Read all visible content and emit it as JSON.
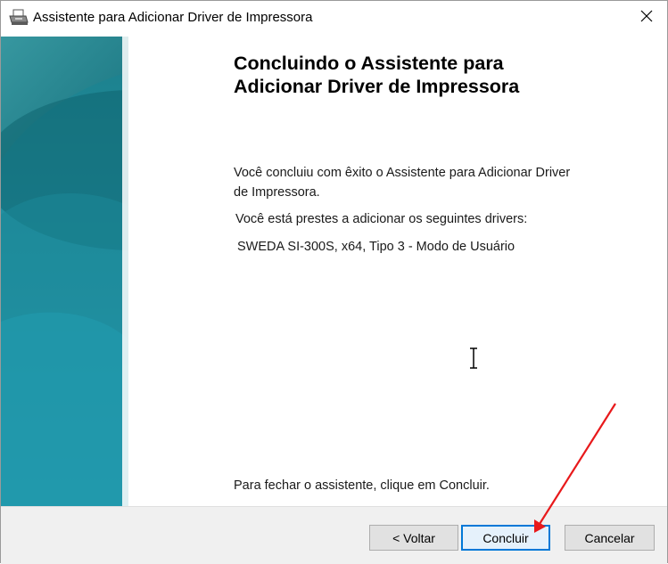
{
  "window": {
    "title": "Assistente para Adicionar Driver de Impressora",
    "icon": "printer-icon",
    "close_icon": "close-icon"
  },
  "content": {
    "heading_line1": "Concluindo o Assistente para",
    "heading_line2": "Adicionar Driver de Impressora",
    "success_line1": "Você concluiu com êxito o Assistente para Adicionar Driver",
    "success_line2": "de Impressora.",
    "drivers_intro": "Você está prestes a adicionar os seguintes drivers:",
    "driver_item": "SWEDA SI-300S, x64, Tipo 3 - Modo de Usuário",
    "close_hint": "Para fechar o assistente, clique em Concluir."
  },
  "buttons": {
    "back": "< Voltar",
    "finish": "Concluir",
    "cancel": "Cancelar"
  },
  "colors": {
    "accent": "#0078d7",
    "annotation_arrow": "#e8191b",
    "side_panel": "#1f7d88"
  }
}
